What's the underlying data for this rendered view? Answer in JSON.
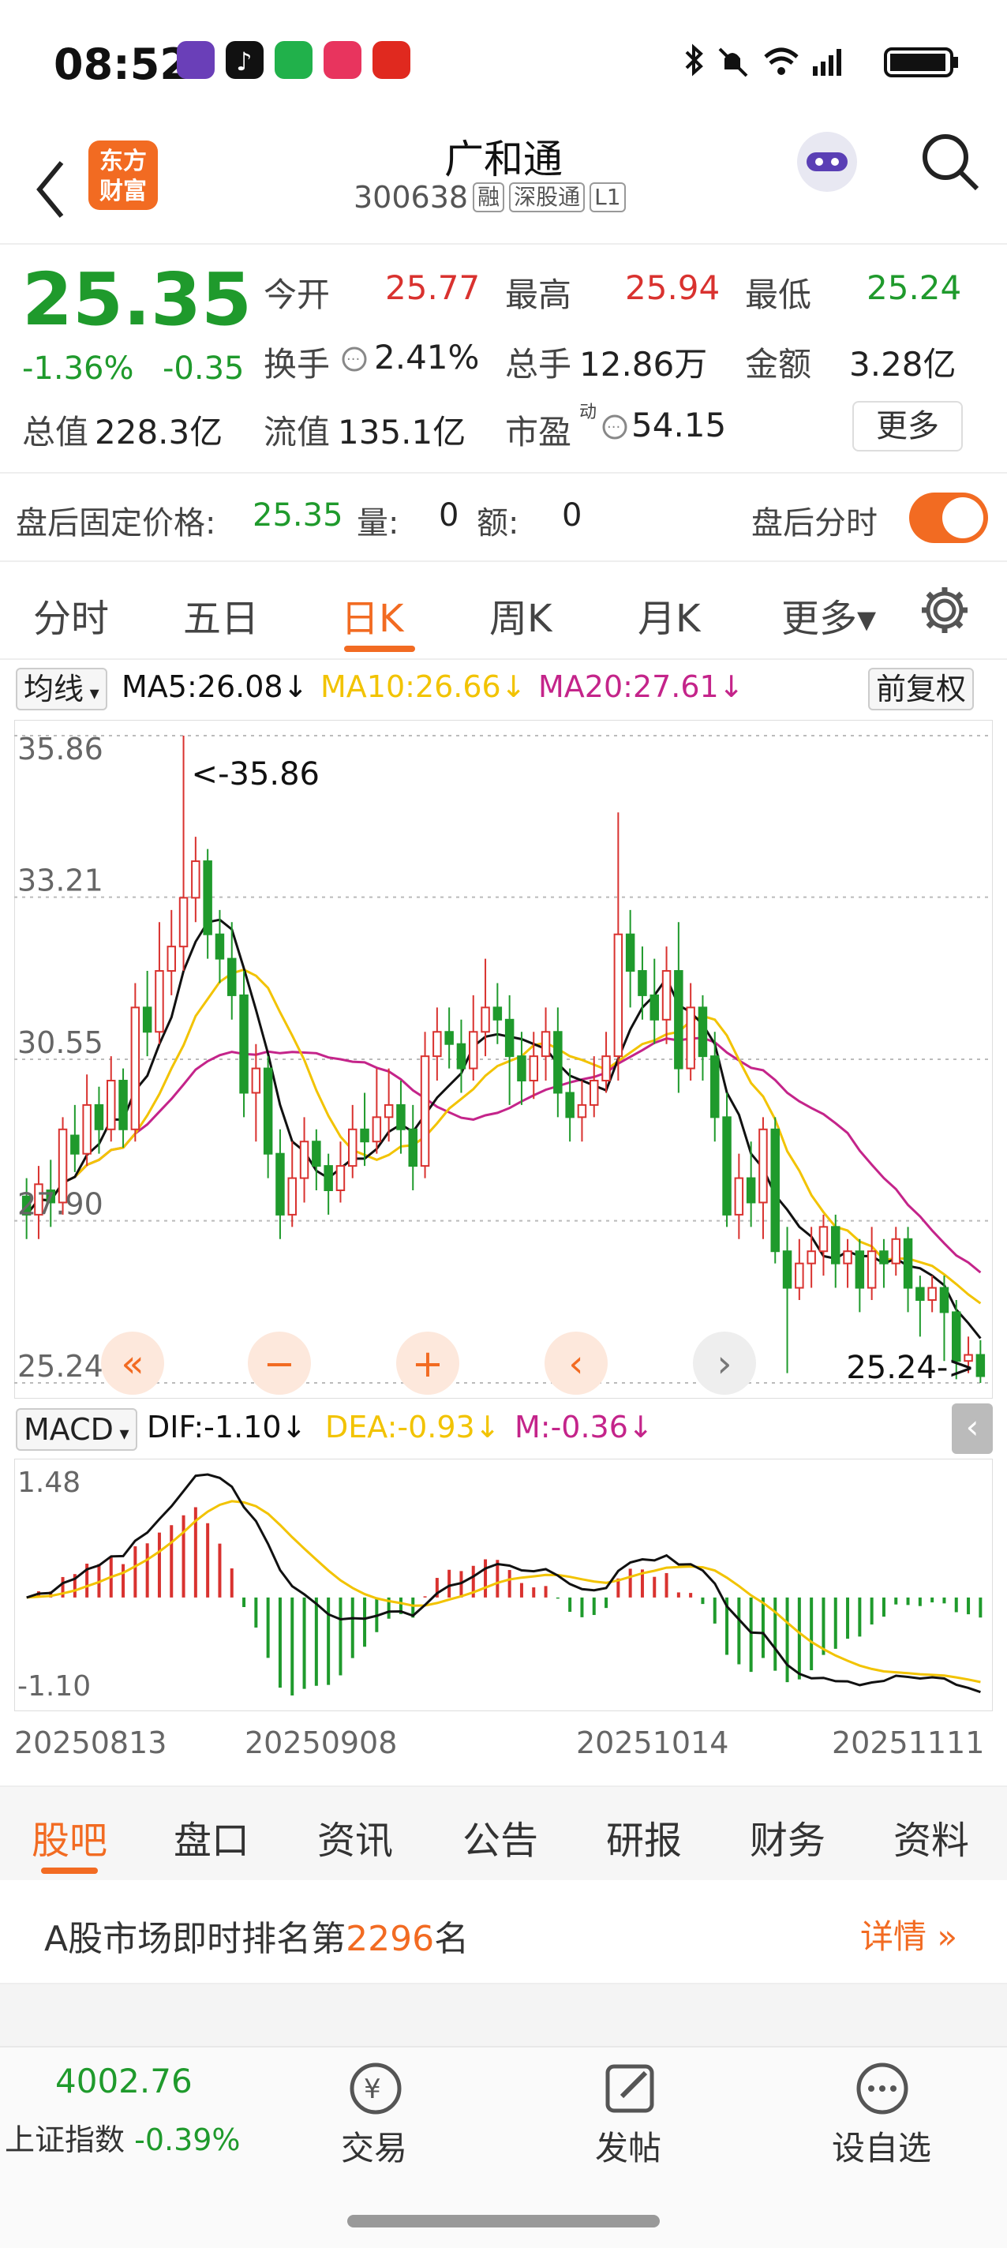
{
  "status_bar": {
    "time": "08:52"
  },
  "header": {
    "logo_text_1": "东方",
    "logo_text_2": "财富",
    "stock_name": "广和通",
    "stock_code": "300638",
    "tags": [
      "融",
      "深股通",
      "L1"
    ]
  },
  "quote": {
    "price": "25.35",
    "change_pct": "-1.36%",
    "change": "-0.35",
    "open_label": "今开",
    "open": "25.77",
    "high_label": "最高",
    "high": "25.94",
    "low_label": "最低",
    "low": "25.24",
    "turnover_label": "换手",
    "turnover": "2.41%",
    "volume_label": "总手",
    "volume": "12.86万",
    "amount_label": "金额",
    "amount": "3.28亿",
    "mcap_label": "总值",
    "mcap": "228.3亿",
    "float_label": "流值",
    "float_cap": "135.1亿",
    "pe_label": "市盈",
    "pe_sup": "动",
    "pe": "54.15",
    "more_button": "更多"
  },
  "after_hours": {
    "label": "盘后固定价格:",
    "price": "25.35",
    "vol_label": "量:",
    "vol": "0",
    "amt_label": "额:",
    "amt": "0",
    "toggle_label": "盘后分时"
  },
  "kline_tabs": [
    "分时",
    "五日",
    "日K",
    "周K",
    "月K",
    "更多▾"
  ],
  "kline_active": "日K",
  "ma_bar": {
    "select": "均线",
    "ma5": "MA5:26.08↓",
    "ma10": "MA10:26.66↓",
    "ma20": "MA20:27.61↓",
    "adjust": "前复权"
  },
  "chart_controls": [
    "«",
    "−",
    "+",
    "‹",
    "›"
  ],
  "colors": {
    "up": "#d9322f",
    "down": "#1f9a2c",
    "ma5": "#111111",
    "ma10": "#f2c300",
    "ma20": "#c4248a",
    "accent": "#f26b22"
  },
  "chart_data": {
    "type": "candlestick",
    "y_ticks": [
      "35.86",
      "33.21",
      "30.55",
      "27.90",
      "25.24"
    ],
    "ylim": [
      25.24,
      35.86
    ],
    "max_label": "<-35.86",
    "min_label": "25.24->",
    "x_ticks": [
      "20250813",
      "20250908",
      "20251014",
      "20251111"
    ],
    "candles": [
      [
        28.3,
        28.0,
        28.6,
        27.6
      ],
      [
        28.0,
        28.5,
        28.8,
        27.6
      ],
      [
        28.4,
        28.2,
        28.9,
        27.8
      ],
      [
        28.2,
        29.4,
        29.6,
        28.0
      ],
      [
        29.3,
        29.0,
        29.8,
        28.7
      ],
      [
        29.0,
        29.8,
        30.3,
        28.8
      ],
      [
        29.8,
        29.4,
        30.1,
        29.0
      ],
      [
        29.4,
        30.2,
        30.6,
        29.2
      ],
      [
        30.2,
        29.4,
        30.4,
        29.1
      ],
      [
        29.4,
        31.4,
        31.8,
        29.2
      ],
      [
        31.4,
        31.0,
        32.0,
        30.6
      ],
      [
        31.0,
        32.0,
        32.8,
        30.8
      ],
      [
        32.0,
        32.4,
        33.0,
        31.6
      ],
      [
        32.4,
        33.2,
        35.86,
        32.0
      ],
      [
        33.2,
        33.8,
        34.2,
        32.8
      ],
      [
        33.8,
        32.6,
        34.0,
        32.2
      ],
      [
        32.6,
        32.2,
        33.0,
        31.8
      ],
      [
        32.2,
        31.6,
        32.8,
        31.2
      ],
      [
        31.6,
        30.0,
        32.0,
        29.6
      ],
      [
        30.0,
        30.4,
        30.8,
        29.2
      ],
      [
        30.4,
        29.0,
        30.6,
        28.6
      ],
      [
        29.0,
        28.0,
        29.4,
        27.6
      ],
      [
        28.0,
        28.6,
        29.2,
        27.8
      ],
      [
        28.6,
        29.2,
        29.6,
        28.2
      ],
      [
        29.2,
        28.8,
        29.4,
        28.4
      ],
      [
        28.8,
        28.4,
        29.0,
        28.0
      ],
      [
        28.4,
        28.8,
        29.2,
        28.2
      ],
      [
        28.8,
        29.4,
        29.8,
        28.6
      ],
      [
        29.4,
        29.2,
        30.0,
        28.8
      ],
      [
        29.2,
        29.6,
        30.4,
        29.0
      ],
      [
        29.6,
        29.8,
        30.4,
        29.2
      ],
      [
        29.8,
        29.4,
        30.2,
        29.0
      ],
      [
        29.4,
        28.8,
        29.8,
        28.4
      ],
      [
        28.8,
        30.6,
        31.0,
        28.6
      ],
      [
        30.6,
        31.0,
        31.4,
        30.2
      ],
      [
        31.0,
        30.8,
        31.4,
        30.4
      ],
      [
        30.8,
        30.4,
        31.2,
        30.0
      ],
      [
        30.4,
        31.0,
        31.6,
        30.2
      ],
      [
        31.0,
        31.4,
        32.2,
        30.6
      ],
      [
        31.4,
        31.2,
        31.8,
        30.8
      ],
      [
        31.2,
        30.6,
        31.6,
        29.8
      ],
      [
        30.6,
        30.2,
        31.0,
        29.8
      ],
      [
        30.2,
        30.6,
        31.0,
        29.9
      ],
      [
        30.6,
        31.0,
        31.4,
        30.2
      ],
      [
        31.0,
        30.0,
        31.4,
        29.6
      ],
      [
        30.0,
        29.6,
        30.4,
        29.2
      ],
      [
        29.6,
        29.8,
        30.2,
        29.2
      ],
      [
        29.8,
        30.2,
        30.6,
        29.6
      ],
      [
        30.2,
        30.6,
        31.0,
        30.0
      ],
      [
        30.6,
        32.6,
        34.6,
        30.2
      ],
      [
        32.6,
        32.0,
        33.0,
        31.4
      ],
      [
        32.0,
        31.6,
        32.4,
        31.2
      ],
      [
        31.6,
        31.2,
        32.2,
        30.8
      ],
      [
        31.2,
        32.0,
        32.4,
        30.8
      ],
      [
        32.0,
        30.4,
        32.8,
        30.0
      ],
      [
        30.4,
        31.4,
        31.8,
        30.2
      ],
      [
        31.4,
        30.6,
        31.6,
        30.2
      ],
      [
        30.6,
        29.6,
        31.0,
        29.2
      ],
      [
        29.6,
        28.0,
        30.0,
        27.8
      ],
      [
        28.0,
        28.6,
        29.0,
        27.6
      ],
      [
        28.6,
        28.2,
        29.2,
        27.8
      ],
      [
        28.2,
        29.4,
        29.6,
        27.6
      ],
      [
        29.4,
        27.4,
        29.6,
        27.2
      ],
      [
        27.4,
        26.8,
        27.8,
        25.4
      ],
      [
        26.8,
        27.2,
        27.6,
        26.6
      ],
      [
        27.2,
        27.4,
        27.8,
        26.8
      ],
      [
        27.4,
        27.8,
        28.0,
        27.0
      ],
      [
        27.8,
        27.2,
        28.0,
        26.8
      ],
      [
        27.2,
        27.4,
        27.6,
        26.8
      ],
      [
        27.4,
        26.8,
        27.6,
        26.4
      ],
      [
        26.8,
        27.4,
        27.8,
        26.6
      ],
      [
        27.4,
        27.2,
        27.6,
        26.8
      ],
      [
        27.2,
        27.6,
        27.8,
        27.0
      ],
      [
        27.6,
        26.8,
        27.8,
        26.4
      ],
      [
        26.8,
        26.6,
        27.0,
        26.0
      ],
      [
        26.6,
        26.8,
        27.0,
        26.4
      ],
      [
        26.8,
        26.4,
        27.0,
        25.6
      ],
      [
        26.4,
        25.6,
        26.6,
        25.3
      ],
      [
        25.6,
        25.7,
        26.0,
        25.4
      ],
      [
        25.7,
        25.35,
        25.94,
        25.24
      ]
    ]
  },
  "macd": {
    "select": "MACD",
    "dif": "DIF:-1.10↓",
    "dea": "DEA:-0.93↓",
    "m": "M:-0.36↓",
    "y_top": "1.48",
    "y_bottom": "-1.10"
  },
  "bottom_tabs": [
    "股吧",
    "盘口",
    "资讯",
    "公告",
    "研报",
    "财务",
    "资料"
  ],
  "rank": {
    "prefix": "A股市场即时排名第",
    "number": "2296",
    "suffix": "名",
    "link": "详情"
  },
  "footer": {
    "index_value": "4002.76",
    "index_name": "上证指数",
    "index_change": "-0.39%",
    "trade": "交易",
    "post": "发帖",
    "watch": "设自选"
  }
}
